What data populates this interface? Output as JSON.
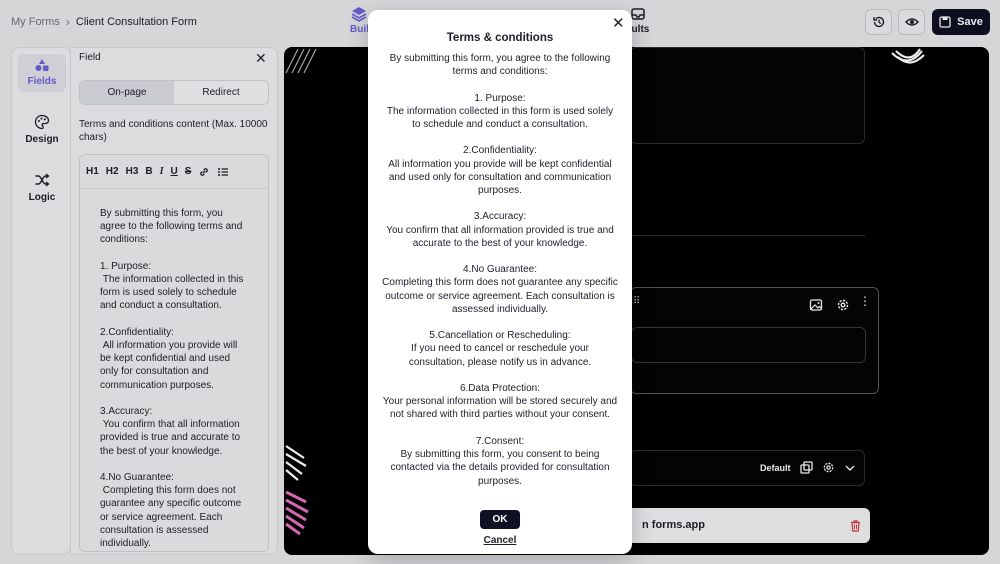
{
  "breadcrumb": {
    "root": "My Forms",
    "current": "Client Consultation Form"
  },
  "nav": {
    "build_label": "Buil",
    "results_label": "sults"
  },
  "toolbar": {
    "save_label": "Save"
  },
  "rail": {
    "fields": "Fields",
    "design": "Design",
    "logic": "Logic"
  },
  "panel": {
    "title": "Field",
    "tabs": [
      "On-page",
      "Redirect"
    ],
    "content_label": "Terms and conditions content (Max. 10000 chars)",
    "editor_tools": [
      "H1",
      "H2",
      "H3",
      "B",
      "I",
      "U",
      "S"
    ],
    "content": "By submitting this form, you agree to the following terms and conditions:\n\n1. Purpose:\n The information collected in this form is used solely to schedule and conduct a consultation.\n\n2.Confidentiality:\n All information you provide will be kept confidential and used only for consultation and communication purposes.\n\n3.Accuracy:\n You confirm that all information provided is true and accurate to the best of your knowledge.\n\n4.No Guarantee:\n Completing this form does not guarantee any specific outcome or service agreement. Each consultation is assessed individually."
  },
  "canvas": {
    "default_label": "Default",
    "footer_text": "n forms.app"
  },
  "modal": {
    "title": "Terms & conditions",
    "body": "By submitting this form, you agree to the following terms and conditions:\n\n1. Purpose:\nThe information collected in this form is used solely to schedule and conduct a consultation.\n\n2.Confidentiality:\nAll information you provide will be kept confidential and used only for consultation and communication purposes.\n\n3.Accuracy:\nYou confirm that all information provided is true and accurate to the best of your knowledge.\n\n4.No Guarantee:\nCompleting this form does not guarantee any specific outcome or service agreement. Each consultation is assessed individually.\n\n5.Cancellation or Rescheduling:\nIf you need to cancel or reschedule your consultation, please notify us in advance.\n\n6.Data Protection:\nYour personal information will be stored securely and not shared with third parties without your consent.\n\n7.Consent:\nBy submitting this form, you consent to being contacted via the details provided for consultation purposes.",
    "ok_label": "OK",
    "cancel_label": "Cancel"
  },
  "colors": {
    "accent": "#6b63d8",
    "dark": "#0f1023",
    "pink": "#e86fc0"
  }
}
